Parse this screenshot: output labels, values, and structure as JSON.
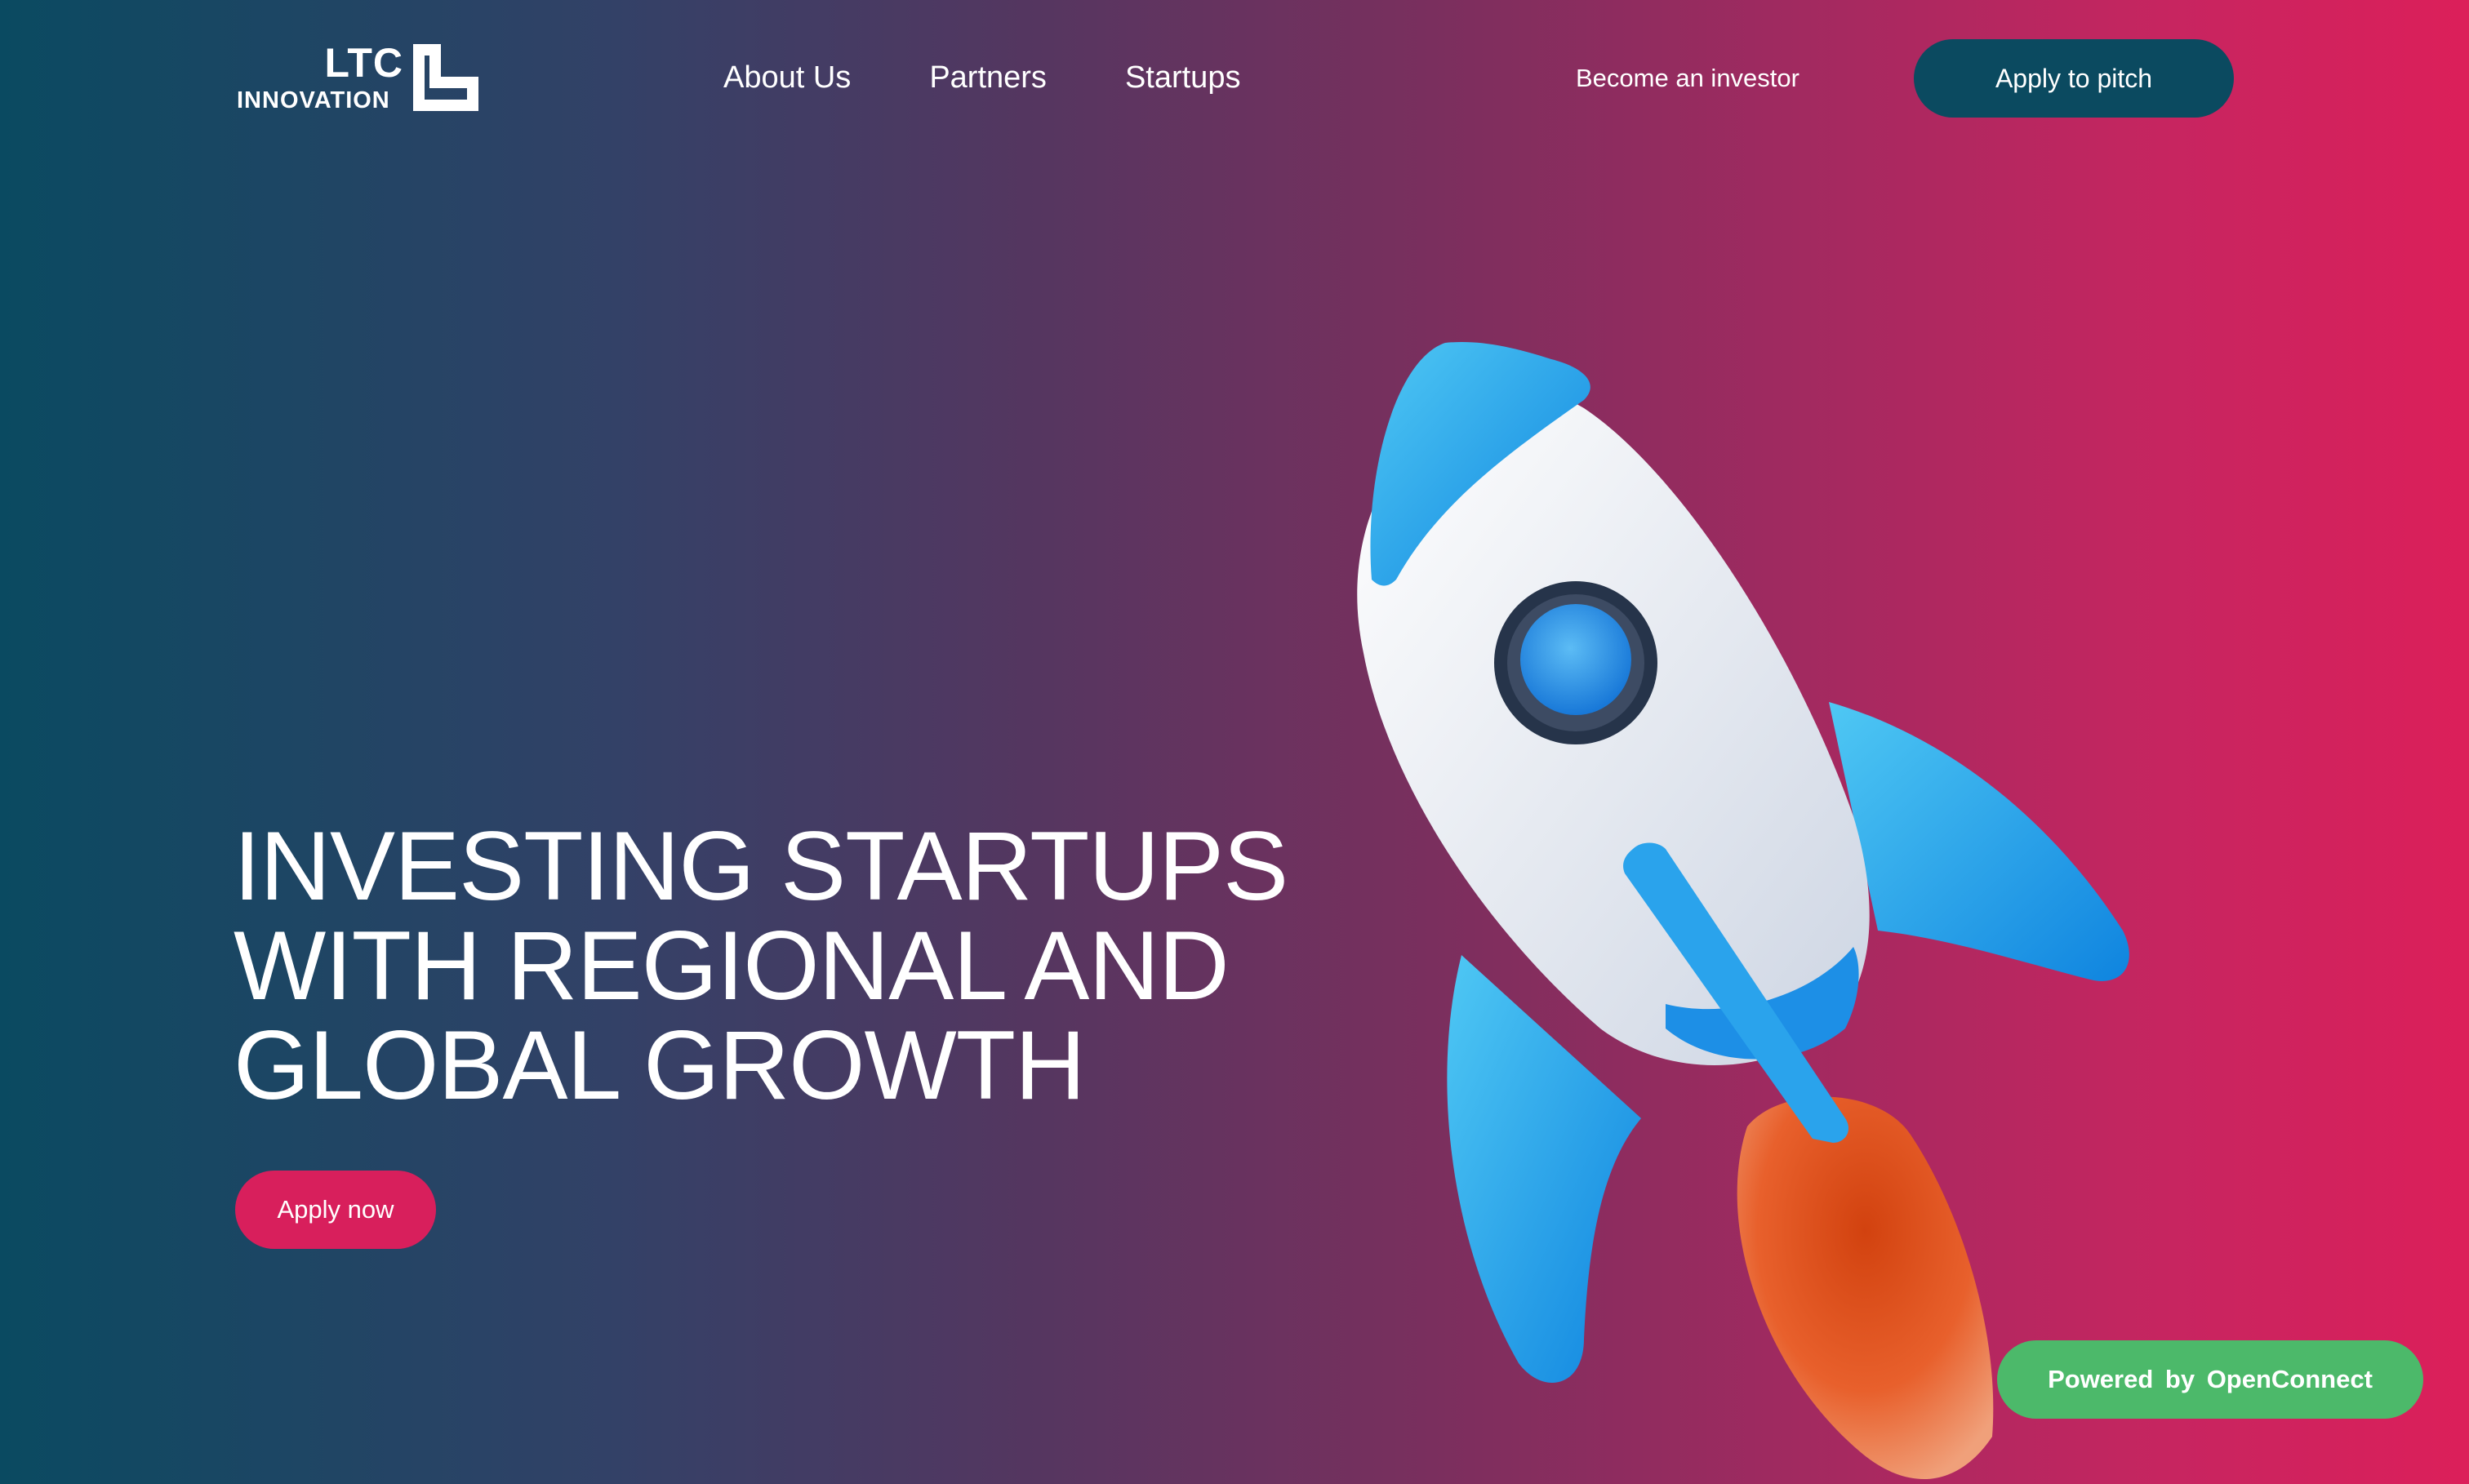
{
  "brand": {
    "logo_top": "LTC",
    "logo_bottom": "INNOVATION"
  },
  "nav": {
    "items": [
      {
        "label": "About Us"
      },
      {
        "label": "Partners"
      },
      {
        "label": "Startups"
      }
    ]
  },
  "header": {
    "investor_link": "Become an investor",
    "pitch_button": "Apply to pitch"
  },
  "hero": {
    "title_lines": [
      "INVESTING STARTUPS",
      "WITH REGIONAL AND",
      "GLOBAL GROWTH"
    ],
    "cta": "Apply now",
    "illustration": "rocket-illustration"
  },
  "badge": {
    "text": "Powered  by  OpenConnect"
  },
  "colors": {
    "gradient_left": "#0a4a61",
    "gradient_right": "#dc1f5a",
    "pitch_button": "#0b4a60",
    "apply_button": "#d81f5c",
    "badge": "#4cb96a",
    "rocket_blue": "#1e9be8",
    "rocket_body": "#e6eaf2",
    "flame": "#e2542a"
  }
}
